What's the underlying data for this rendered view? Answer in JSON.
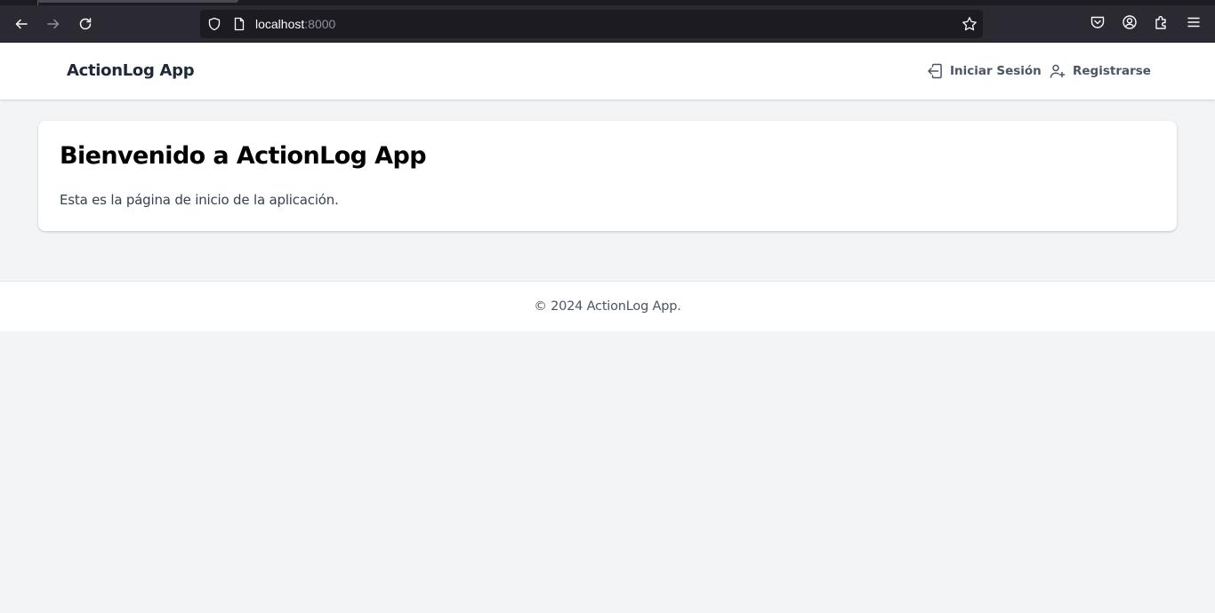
{
  "browser": {
    "url_host": "localhost",
    "url_port": ":8000"
  },
  "header": {
    "brand": "ActionLog App",
    "nav": {
      "login_label": "Iniciar Sesión",
      "register_label": "Registrarse"
    }
  },
  "main": {
    "title": "Bienvenido a ActionLog App",
    "description": "Esta es la página de inicio de la aplicación."
  },
  "footer": {
    "text": "© 2024 ActionLog App."
  },
  "icons": {
    "back": "arrow-left-icon",
    "forward": "arrow-right-icon",
    "reload": "reload-icon",
    "shield": "shield-icon",
    "page": "page-icon",
    "bookmark": "star-icon",
    "pocket": "pocket-icon",
    "account": "account-icon",
    "extensions": "puzzle-icon",
    "menu": "hamburger-menu-icon",
    "login": "login-icon",
    "register": "user-plus-icon"
  },
  "colors": {
    "page_background": "#f3f4f6",
    "header_background": "#ffffff",
    "brand_text": "#1f2937",
    "nav_text": "#4b5563",
    "browser_chrome": "#2b2a33"
  }
}
